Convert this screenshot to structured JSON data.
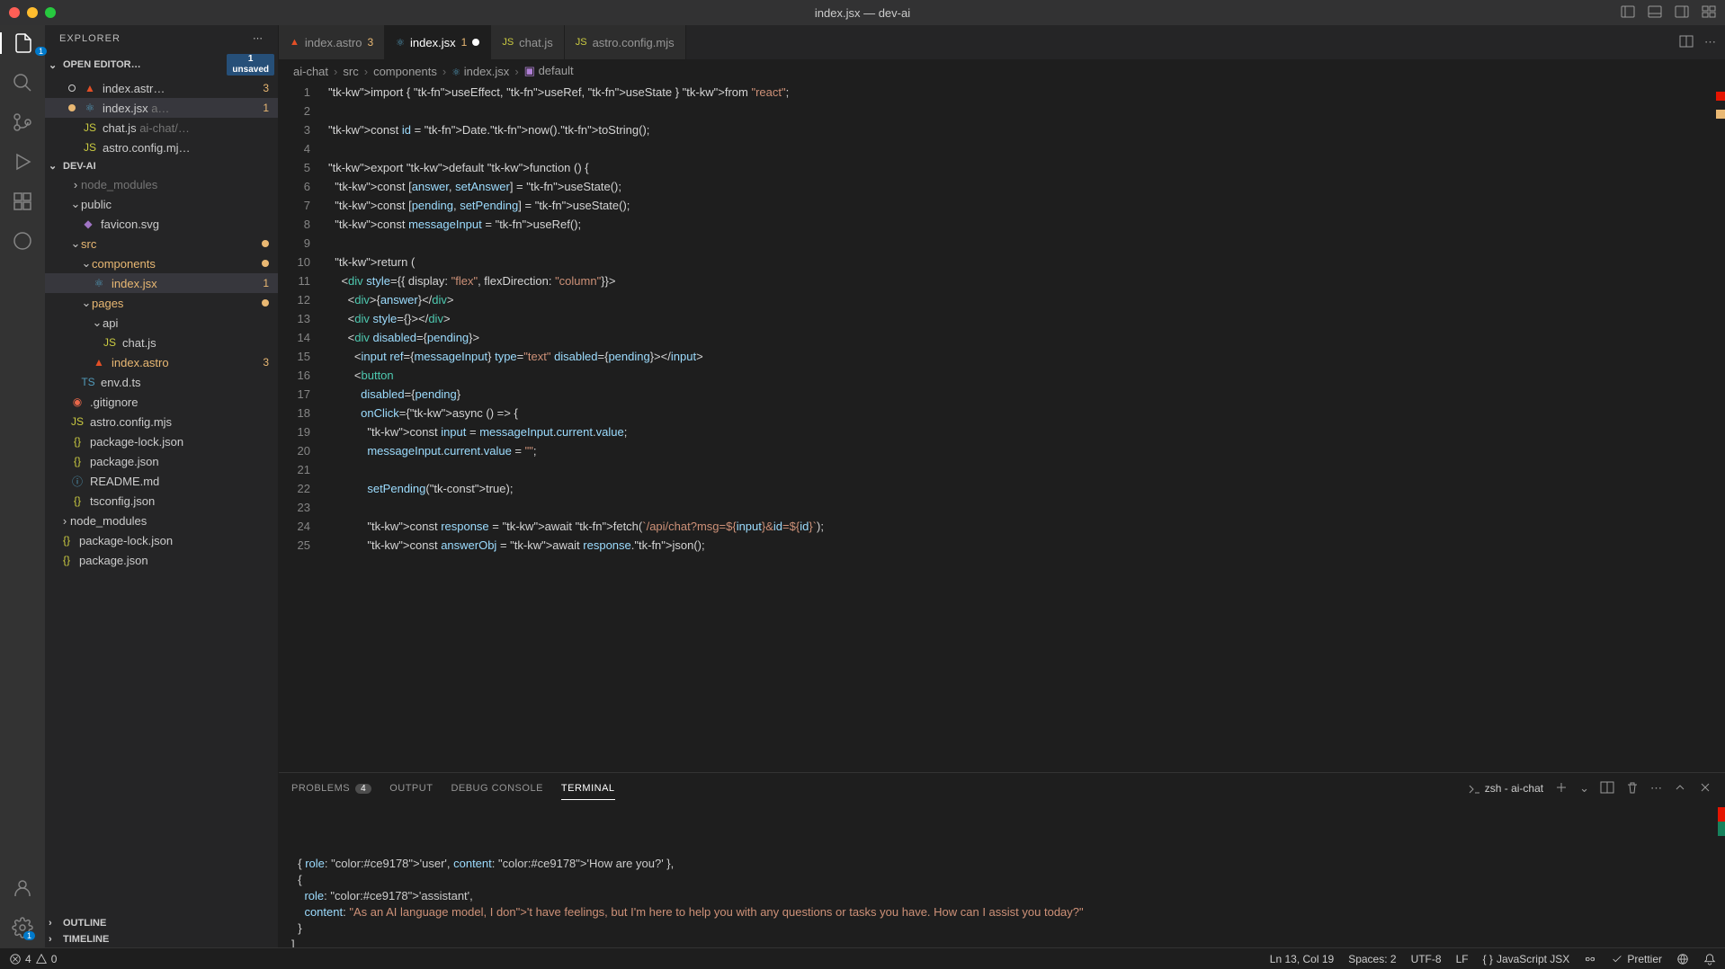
{
  "title": "index.jsx — dev-ai",
  "explorer": {
    "label": "EXPLORER"
  },
  "openEditors": {
    "label": "OPEN EDITOR…",
    "unsaved": {
      "count": "1",
      "label": "unsaved"
    },
    "items": [
      {
        "name": "index.astr…",
        "badge": "3",
        "icon": "astro",
        "dirty": false
      },
      {
        "name": "index.jsx",
        "meta": "a…",
        "badge": "1",
        "icon": "jsx",
        "dirty": true
      },
      {
        "name": "chat.js",
        "meta": "ai-chat/…",
        "icon": "js"
      },
      {
        "name": "astro.config.mj…",
        "icon": "js"
      }
    ]
  },
  "workspace": {
    "name": "DEV-AI",
    "tree": [
      {
        "name": "node_modules",
        "type": "folder",
        "depth": 1,
        "dim": true
      },
      {
        "name": "public",
        "type": "folder",
        "depth": 1,
        "open": true
      },
      {
        "name": "favicon.svg",
        "type": "file",
        "depth": 2,
        "icon": "svg"
      },
      {
        "name": "src",
        "type": "folder",
        "depth": 1,
        "open": true,
        "mod": true
      },
      {
        "name": "components",
        "type": "folder",
        "depth": 2,
        "open": true,
        "mod": true
      },
      {
        "name": "index.jsx",
        "type": "file",
        "depth": 3,
        "icon": "jsx",
        "badge": "1",
        "selected": true
      },
      {
        "name": "pages",
        "type": "folder",
        "depth": 2,
        "open": true,
        "mod": true
      },
      {
        "name": "api",
        "type": "folder",
        "depth": 3,
        "open": true
      },
      {
        "name": "chat.js",
        "type": "file",
        "depth": 4,
        "icon": "js"
      },
      {
        "name": "index.astro",
        "type": "file",
        "depth": 3,
        "icon": "astro",
        "badge": "3"
      },
      {
        "name": "env.d.ts",
        "type": "file",
        "depth": 2,
        "icon": "ts"
      },
      {
        "name": ".gitignore",
        "type": "file",
        "depth": 1,
        "icon": "git"
      },
      {
        "name": "astro.config.mjs",
        "type": "file",
        "depth": 1,
        "icon": "js"
      },
      {
        "name": "package-lock.json",
        "type": "file",
        "depth": 1,
        "icon": "json"
      },
      {
        "name": "package.json",
        "type": "file",
        "depth": 1,
        "icon": "json"
      },
      {
        "name": "README.md",
        "type": "file",
        "depth": 1,
        "icon": "md"
      },
      {
        "name": "tsconfig.json",
        "type": "file",
        "depth": 1,
        "icon": "json"
      },
      {
        "name": "node_modules",
        "type": "folder",
        "depth": 0
      },
      {
        "name": "package-lock.json",
        "type": "file",
        "depth": 0,
        "icon": "json"
      },
      {
        "name": "package.json",
        "type": "file",
        "depth": 0,
        "icon": "json"
      }
    ]
  },
  "outline": "OUTLINE",
  "timeline": "TIMELINE",
  "tabs": [
    {
      "name": "index.astro",
      "badge": "3",
      "icon": "astro"
    },
    {
      "name": "index.jsx",
      "badge": "1",
      "icon": "jsx",
      "active": true,
      "dirty": true
    },
    {
      "name": "chat.js",
      "icon": "js"
    },
    {
      "name": "astro.config.mjs",
      "icon": "js"
    }
  ],
  "breadcrumb": [
    "ai-chat",
    "src",
    "components",
    "index.jsx",
    "default"
  ],
  "code": {
    "lines": [
      "import { useEffect, useRef, useState } from \"react\";",
      "",
      "const id = Date.now().toString();",
      "",
      "export default function () {",
      "  const [answer, setAnswer] = useState();",
      "  const [pending, setPending] = useState();",
      "  const messageInput = useRef();",
      "",
      "  return (",
      "    <div style={{ display: \"flex\", flexDirection: \"column\"}}>",
      "      <div>{answer}</div>",
      "      <div style={}></div>",
      "      <div disabled={pending}>",
      "        <input ref={messageInput} type=\"text\" disabled={pending}></input>",
      "        <button",
      "          disabled={pending}",
      "          onClick={async () => {",
      "            const input = messageInput.current.value;",
      "            messageInput.current.value = \"\";",
      "",
      "            setPending(true);",
      "",
      "            const response = await fetch(`/api/chat?msg=${input}&id=${id}`);",
      "            const answerObj = await response.json();"
    ]
  },
  "panel": {
    "tabs": [
      {
        "label": "PROBLEMS",
        "count": "4"
      },
      {
        "label": "OUTPUT"
      },
      {
        "label": "DEBUG CONSOLE"
      },
      {
        "label": "TERMINAL",
        "active": true
      }
    ],
    "terminal_name": "zsh - ai-chat",
    "content": "  { role: 'user', content: 'How are you?' },\n  {\n    role: 'assistant',\n    content: \"As an AI language model, I don't have feelings, but I'm here to help you with any questions or tasks you have. How can I assist you today?\"\n  }\n]\n▮"
  },
  "statusbar": {
    "errors": "4",
    "warnings": "0",
    "cursor": "Ln 13, Col 19",
    "spaces": "Spaces: 2",
    "encoding": "UTF-8",
    "eol": "LF",
    "language": "JavaScript JSX",
    "prettier": "Prettier"
  }
}
